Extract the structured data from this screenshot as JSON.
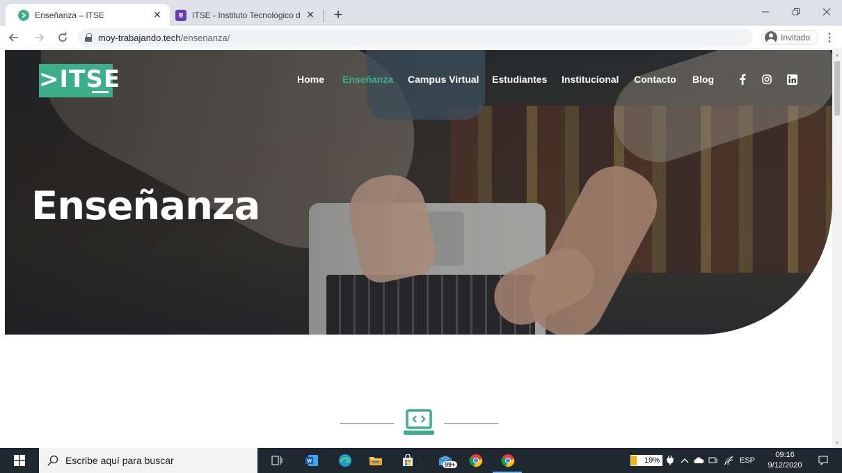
{
  "browser": {
    "tabs": [
      {
        "title": "Enseñanza – ITSE",
        "favicon": "itse-favicon-icon",
        "active": true
      },
      {
        "title": "ITSE - Instituto Tecnológico de Se",
        "favicon": "forms-favicon-icon",
        "active": false
      }
    ],
    "new_tab": "+",
    "url_host": "moy-trabajando.tech",
    "url_path": "/ensenanza/",
    "profile_label": "Invitado"
  },
  "site": {
    "logo_text": ">ITSE",
    "nav": [
      {
        "label": "Home",
        "active": false
      },
      {
        "label": "Enseñanza",
        "active": true
      },
      {
        "label": "Campus Virtual",
        "active": false
      },
      {
        "label": "Estudiantes",
        "active": false
      },
      {
        "label": "Institucional",
        "active": false
      },
      {
        "label": "Contacto",
        "active": false
      },
      {
        "label": "Blog",
        "active": false
      }
    ],
    "social": [
      "facebook-icon",
      "instagram-icon",
      "linkedin-icon"
    ],
    "hero_title": "Enseñanza",
    "accent_color": "#3dae8a"
  },
  "taskbar": {
    "search_placeholder": "Escribe aquí para buscar",
    "mail_badge": "99+",
    "battery_percent": "19%",
    "battery_level": 0.19,
    "language": "ESP",
    "time": "09:16",
    "date": "9/12/2020"
  }
}
